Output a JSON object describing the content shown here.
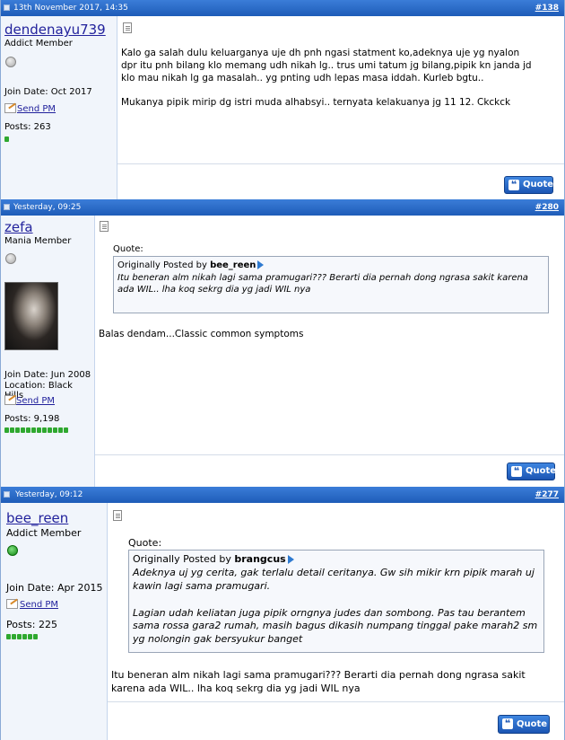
{
  "posts": [
    {
      "date": "13th November 2017, 14:35",
      "number": "#138",
      "username": "dendenayu739",
      "user_title": "Addict Member",
      "online": false,
      "join_date": "Join Date: Oct 2017",
      "send_pm": "Send PM",
      "posts": "Posts: 263",
      "rep_bars": 1,
      "message": "Kalo ga salah dulu keluarganya uje dh pnh ngasi statment ko,adeknya uje yg nyalon dpr itu pnh bilang klo memang udh nikah lg.. trus umi tatum jg bilang,pipik kn janda jd klo mau nikah lg ga masalah.. yg pnting udh lepas masa iddah. Kurleb bgtu..",
      "message2": "Mukanya pipik mirip dg istri muda alhabsyi.. ternyata kelakuanya jg 11 12. Ckckck",
      "quote_button": "Quote"
    },
    {
      "date": "Yesterday, 09:25",
      "number": "#280",
      "username": "zefa",
      "user_title": "Mania Member",
      "online": false,
      "join_date": "Join Date: Jun 2008",
      "location": "Location: Black Hills",
      "send_pm": "Send PM",
      "posts": "Posts: 9,198",
      "rep_bars": 12,
      "quote_label": "Quote:",
      "quote_prefix": "Originally Posted by",
      "quote_author": "bee_reen",
      "quote_text": "Itu beneran alm nikah lagi sama pramugari??? Berarti dia pernah dong ngrasa sakit karena ada WIL.. lha koq sekrg dia yg jadi WIL nya",
      "message": "Balas dendam...Classic common symptoms",
      "quote_button": "Quote"
    },
    {
      "date": "Yesterday, 09:12",
      "number": "#277",
      "username": "bee_reen",
      "user_title": "Addict Member",
      "online": true,
      "join_date": "Join Date: Apr 2015",
      "send_pm": "Send PM",
      "posts": "Posts: 225",
      "rep_bars": 6,
      "quote_label": "Quote:",
      "quote_prefix": "Originally Posted by",
      "quote_author": "brangcus",
      "quote_text": "Adeknya uj yg cerita, gak terlalu detail ceritanya. Gw sih mikir krn pipik marah uj kawin lagi sama pramugari.",
      "quote_text2": "Lagian udah keliatan juga pipik orngnya judes dan sombong. Pas tau berantem sama rossa gara2 rumah, masih bagus dikasih numpang tinggal pake marah2 sm yg nolongin gak bersyukur banget",
      "message": "Itu beneran alm nikah lagi sama pramugari??? Berarti dia pernah dong ngrasa sakit karena ada WIL.. lha koq sekrg dia yg jadi WIL nya",
      "quote_button": "Quote"
    }
  ]
}
